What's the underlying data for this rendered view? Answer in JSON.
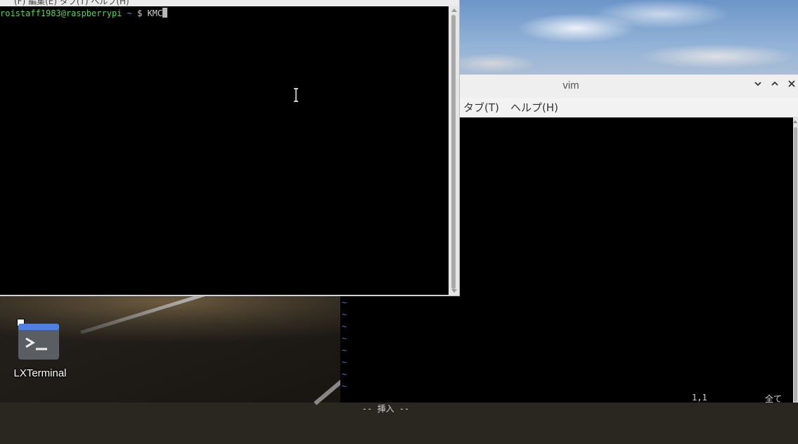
{
  "terminal": {
    "menu_partial": "(F)   編集(E)   タブ(T)   ヘルプ(H)",
    "prompt_user": "roistaff1983@raspberrypi",
    "prompt_path": "~",
    "prompt_symbol": "$",
    "input_text": "KMC"
  },
  "vim_window": {
    "title": "vim",
    "menu": {
      "tab": "タブ(T)",
      "help": "ヘルプ(H)"
    },
    "controls": {
      "minimize": "⌄",
      "maximize": "⌃",
      "close": "✕"
    },
    "tilde_lines": [
      "~",
      "~",
      "~",
      "~",
      "~",
      "~",
      "~",
      "~"
    ],
    "status": {
      "mode": "-- 挿入 --",
      "position": "1,1",
      "scroll": "全て"
    }
  },
  "desktop": {
    "icons": [
      {
        "label": "LXTerminal",
        "icon": "terminal-icon"
      }
    ]
  },
  "colors": {
    "prompt_user": "#5ad25a",
    "prompt_path": "#5b8fe0",
    "tilde": "#4a6fd0",
    "terminal_bg": "#000000"
  }
}
